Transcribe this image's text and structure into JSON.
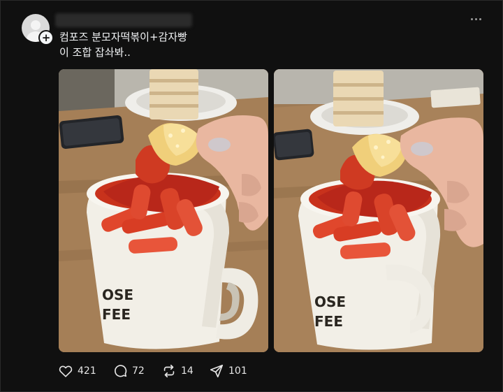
{
  "post": {
    "text_line_1": "컴포즈 분모자떡볶이+감자빵",
    "text_line_2": "이 조합 잡솨봐..",
    "mug_text": [
      "OSE",
      "FEE"
    ]
  },
  "icons": {
    "avatar": "default-avatar-icon",
    "follow": "plus-icon",
    "more": "more-horizontal-icon",
    "like": "heart-icon",
    "reply": "comment-bubble-icon",
    "repost": "repost-icon",
    "share": "send-icon"
  },
  "actions": {
    "likes": "421",
    "replies": "72",
    "reposts": "14",
    "shares": "101"
  },
  "colors": {
    "background": "#101010",
    "text": "#f3f5f7",
    "sauce": "#c8321c"
  }
}
